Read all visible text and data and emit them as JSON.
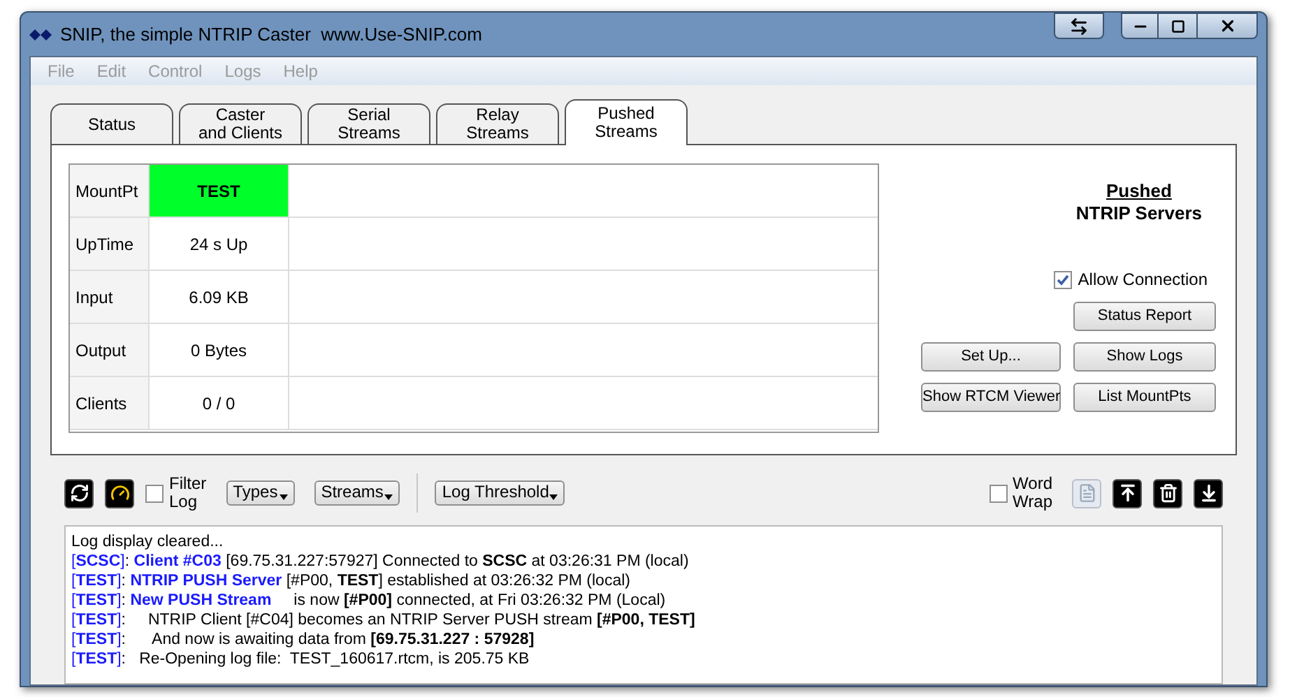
{
  "window": {
    "title": "SNIP, the simple NTRIP Caster  www.Use-SNIP.com"
  },
  "menu": [
    {
      "label": "File",
      "disabled": true
    },
    {
      "label": "Edit",
      "disabled": true
    },
    {
      "label": "Control",
      "disabled": true
    },
    {
      "label": "Logs",
      "disabled": true
    },
    {
      "label": "Help",
      "disabled": true
    }
  ],
  "tabs": [
    {
      "label": "Status",
      "selected": false
    },
    {
      "label": "Caster\nand Clients",
      "selected": false
    },
    {
      "label": "Serial\nStreams",
      "selected": false
    },
    {
      "label": "Relay\nStreams",
      "selected": false
    },
    {
      "label": "Pushed\nStreams",
      "selected": true
    }
  ],
  "status_table": [
    {
      "label": "MountPt",
      "value": "TEST",
      "highlight": true
    },
    {
      "label": "UpTime",
      "value": "24 s Up",
      "highlight": false
    },
    {
      "label": "Input",
      "value": "6.09 KB",
      "highlight": false
    },
    {
      "label": "Output",
      "value": "0 Bytes",
      "highlight": false
    },
    {
      "label": "Clients",
      "value": "0 / 0",
      "highlight": false
    }
  ],
  "panel_heading": {
    "title": "Pushed",
    "subtitle": "NTRIP Servers"
  },
  "allow_connection": {
    "label": "Allow Connection",
    "checked": true
  },
  "buttons_left": [
    "Set Up...",
    "Show RTCM Viewer"
  ],
  "buttons_right": [
    "Status Report",
    "Show Logs",
    "List MountPts"
  ],
  "log_toolbar": {
    "filter_log": {
      "label": "Filter\nLog",
      "checked": false
    },
    "dropdowns": [
      "Types",
      "Streams"
    ],
    "threshold": "Log Threshold",
    "word_wrap": {
      "label": "Word\nWrap",
      "checked": false
    },
    "copy_disabled": true
  },
  "log_lines": [
    [
      {
        "kind": "plain",
        "text": "Log display cleared..."
      }
    ],
    [
      {
        "kind": "tag",
        "text": "[**SCSC**]"
      },
      {
        "kind": "plain",
        "text": ":"
      },
      {
        "kind": "name",
        "text": "Client #C03"
      },
      {
        "kind": "plain",
        "text": "[69.75.31.227:57927] Connected to **SCSC** at 03:26:31 PM (local)"
      }
    ],
    [
      {
        "kind": "tag",
        "text": "[**TEST**]"
      },
      {
        "kind": "plain",
        "text": ":"
      },
      {
        "kind": "name",
        "text": "NTRIP PUSH Server"
      },
      {
        "kind": "plain",
        "text": "[#P00, **TEST**] established at 03:26:32 PM (local)"
      }
    ],
    [
      {
        "kind": "tag",
        "text": "[**TEST**]"
      },
      {
        "kind": "plain",
        "text": ":"
      },
      {
        "kind": "name",
        "text": "New PUSH Stream"
      },
      {
        "kind": "plain",
        "text": "    is now **[#P00]** connected, at Fri 03:26:32 PM (Local)"
      }
    ],
    [
      {
        "kind": "tag",
        "text": "[**TEST**]"
      },
      {
        "kind": "plain",
        "text": ":     NTRIP Client [#C04] becomes an NTRIP Server PUSH stream **[#P00, TEST]**"
      }
    ],
    [
      {
        "kind": "tag",
        "text": "[**TEST**]"
      },
      {
        "kind": "plain",
        "text": ":      And now is awaiting data from **[69.75.31.227 : 57928]**"
      }
    ],
    [
      {
        "kind": "tag",
        "text": "[**TEST**]"
      },
      {
        "kind": "plain",
        "text": ":   Re-Opening log file:  TEST_160617.rtcm, is 205.75 KB"
      }
    ]
  ]
}
